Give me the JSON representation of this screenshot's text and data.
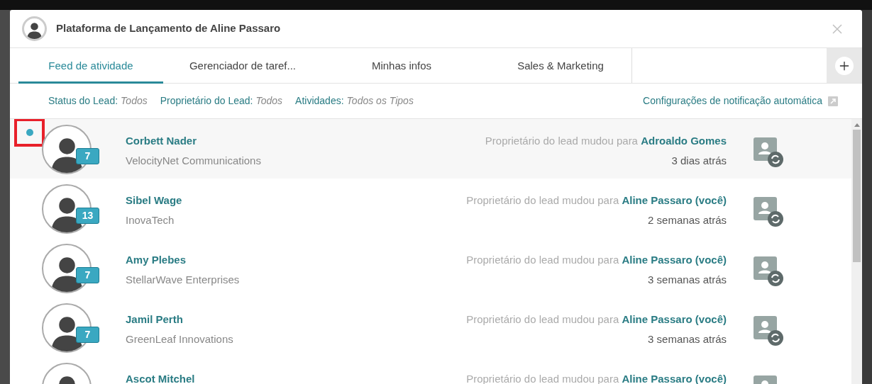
{
  "dialog": {
    "title": "Plataforma de Lançamento de Aline Passaro"
  },
  "tabs": [
    {
      "label": "Feed de atividade",
      "selected": true
    },
    {
      "label": "Gerenciador de taref...",
      "selected": false
    },
    {
      "label": "Minhas infos",
      "selected": false
    },
    {
      "label": "Sales & Marketing",
      "selected": false
    }
  ],
  "filters": [
    {
      "label": "Status do Lead:",
      "value": "Todos"
    },
    {
      "label": "Proprietário do Lead:",
      "value": "Todos"
    },
    {
      "label": "Atividades:",
      "value": "Todos os Tipos"
    }
  ],
  "settings_link": "Configurações de notificação automática",
  "feed": [
    {
      "name": "Corbett Nader",
      "company": "VelocityNet Communications",
      "count": "7",
      "message": "Proprietário do lead mudou para **Adroaldo Gomes**",
      "time": "3 dias atrás",
      "unread": true,
      "highlighted": true
    },
    {
      "name": "Sibel Wage",
      "company": "InovaTech",
      "count": "13",
      "message": "Proprietário do lead mudou para **Aline Passaro (você)**",
      "time": "2 semanas atrás",
      "unread": false,
      "highlighted": false
    },
    {
      "name": "Amy Plebes",
      "company": "StellarWave Enterprises",
      "count": "7",
      "message": "Proprietário do lead mudou para **Aline Passaro (você)**",
      "time": "3 semanas atrás",
      "unread": false,
      "highlighted": false
    },
    {
      "name": "Jamil Perth",
      "company": "GreenLeaf Innovations",
      "count": "7",
      "message": "Proprietário do lead mudou para **Aline Passaro (você)**",
      "time": "3 semanas atrás",
      "unread": false,
      "highlighted": false
    },
    {
      "name": "Ascot Mitchel",
      "message": "Proprietário do lead mudou para **Aline Passaro (você)**",
      "unread": false,
      "highlighted": false
    }
  ]
}
